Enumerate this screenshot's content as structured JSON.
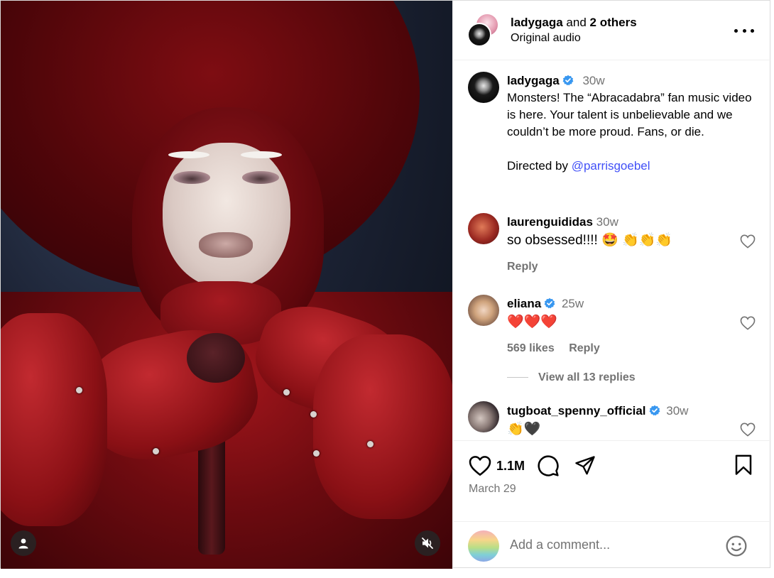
{
  "header": {
    "username": "ladygaga",
    "and_text": " and ",
    "others": "2 others",
    "audio": "Original audio"
  },
  "caption": {
    "username": "ladygaga",
    "time": "30w",
    "text": "Monsters! The “Abracadabra” fan music video is here. Your talent is unbelievable and we couldn’t be more proud. Fans, or die.\n\nDirected by ",
    "mention": "@parrisgoebel"
  },
  "comments": [
    {
      "username": "laurenguididas",
      "time": "30w",
      "text": "so obsessed!!!! 🤩 👏👏👏",
      "reply": "Reply"
    },
    {
      "username": "eliana",
      "time": "25w",
      "text": "❤️❤️❤️",
      "likes": "569 likes",
      "reply": "Reply",
      "view_replies": "View all 13 replies"
    },
    {
      "username": "tugboat_spenny_official",
      "time": "30w",
      "text": "👏🖤"
    }
  ],
  "footer": {
    "likes": "1.1M",
    "date": "March 29",
    "comment_placeholder": "Add a comment..."
  },
  "icons": {
    "verified_color": "#3897f0",
    "mention_color": "#4150f7",
    "secondary_text": "#737373"
  }
}
